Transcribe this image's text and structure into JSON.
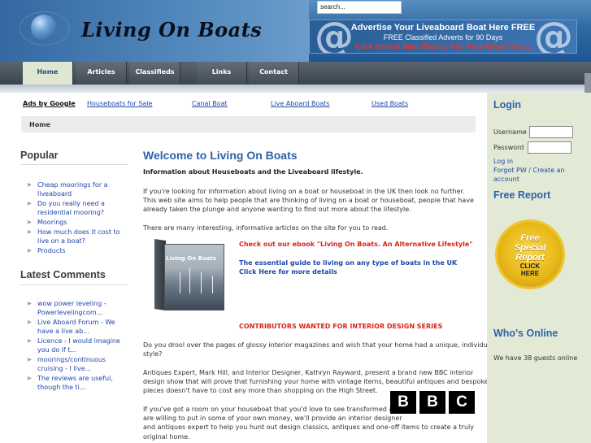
{
  "header": {
    "logo_text": "Living On Boats",
    "search_value": "search...",
    "ad_banner": {
      "line1": "Advertise Your Liveaboard Boat Here FREE",
      "line2": "FREE Classified Adverts for 90 Days",
      "line3": "Click Here to Start Placing Your Free Advert Today"
    }
  },
  "nav": {
    "items": [
      {
        "label": "Home",
        "active": true
      },
      {
        "label": "Articles",
        "active": false
      },
      {
        "label": "Classifieds",
        "active": false
      },
      {
        "label": "Links",
        "active": false
      },
      {
        "label": "Contact",
        "active": false
      }
    ]
  },
  "ads": {
    "ads_by": "Ads by Google",
    "links": [
      "Houseboats for Sale",
      "Canal Boat",
      "Live Aboard Boats",
      "Used Boats"
    ]
  },
  "breadcrumb": "Home",
  "sidebar": {
    "popular_title": "Popular",
    "popular_items": [
      "Cheap moorings for a liveaboard",
      "Do you really need a residential mooring?",
      "Moorings",
      "How much does it cost to live on a boat?",
      "Products"
    ],
    "comments_title": "Latest Comments",
    "comment_items": [
      "wow power leveling - Powerlevelingcom...",
      "Live Aboard Forum - We have a live ab...",
      "Licence - I would imagine you do if t...",
      "moorings/continuous cruising - I live...",
      "The reviews are useful, though the ti..."
    ]
  },
  "article": {
    "title": "Welcome to Living On Boats",
    "intro_bold": "Information about Houseboats and the Liveaboard lifestyle.",
    "p1_line1": "If you're looking for information about living on a boat or houseboat in the UK then look no further.",
    "p1_line2": "This web site aims to help people that are thinking of living on a boat or houseboat, people that have",
    "p1_line3": "already taken the plunge and anyone wanting to find out more about the lifestyle.",
    "p2": "There are many interesting, informative articles on the site for you to read.",
    "book_title": "Living On Boats",
    "ebook_line": "Check out our ebook \"Living On Boats. An Alternative Lifestyle\"",
    "guide_line": "The essential guide to living on any type of boats in the UK",
    "click_line": "Click Here for more details",
    "contrib_line": "CONTRIBUTORS WANTED FOR INTERIOR DESIGN SERIES",
    "p3_line1": "Do you drool over the pages of glossy interior magazines and wish that your home had a unique, individual",
    "p3_line2": "style?",
    "p4_line1": "Antiques Expert, Mark Hill, and Interior Designer, Kathryn Rayward, present a brand new BBC interior",
    "p4_line2": "design show that will prove that furnishing your home with vintage items, beautiful antiques and bespoke",
    "p4_line3": "pieces doesn't have to cost any more than shopping on the High Street.",
    "p5_line1": "If you've got a room on your houseboat that you'd love to see transformed and",
    "p5_line2": "are willing to put in some of your own money, we'll provide an interior designer",
    "p5_line3": "and antiques expert to help you hunt out design classics, antiques and one-off items to create a truly",
    "p5_line4": "original home.",
    "bbc_letters": [
      "B",
      "B",
      "C"
    ]
  },
  "right": {
    "login_title": "Login",
    "username_label": "Username",
    "password_label": "Password",
    "login_link": "Log in",
    "forgot_link": "Forgot PW / Create an account",
    "report_title": "Free Report",
    "seal_line1": "Free",
    "seal_line2": "Special",
    "seal_line3": "Report",
    "seal_click1": "CLICK",
    "seal_click2": "HERE",
    "online_title": "Who's Online",
    "online_text": "We have 38 guests online"
  }
}
